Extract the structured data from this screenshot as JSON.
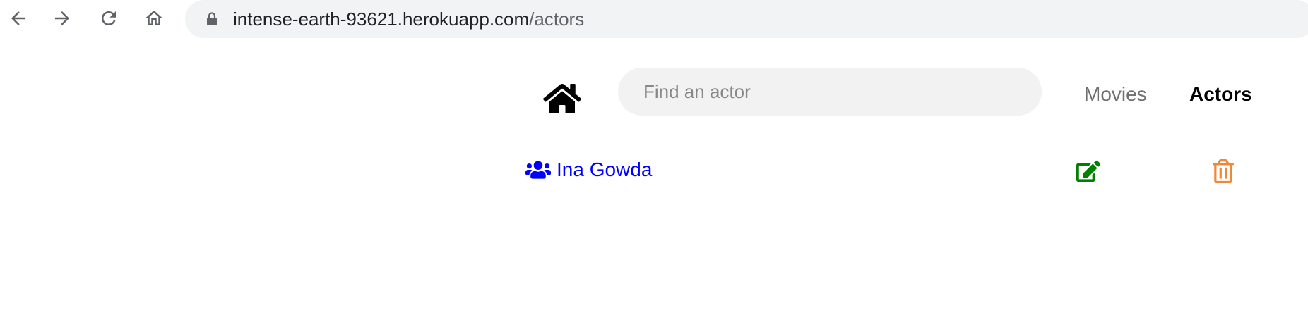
{
  "browser": {
    "url_host": "intense-earth-93621.herokuapp.com",
    "url_path": "/actors",
    "icons": [
      "back-arrow-icon",
      "forward-arrow-icon",
      "reload-icon",
      "home-icon",
      "lock-icon"
    ]
  },
  "navbar": {
    "home_icon": "home-icon",
    "search_placeholder": "Find an actor",
    "search_value": "",
    "links": [
      {
        "label": "Movies",
        "active": false
      },
      {
        "label": "Actors",
        "active": true
      }
    ]
  },
  "actors": [
    {
      "name": "Ina Gowda",
      "icon": "users-icon",
      "edit_icon": "edit-icon",
      "delete_icon": "trash-icon"
    }
  ],
  "colors": {
    "link": "#0000ff",
    "edit": "#008000",
    "delete": "#f0883a",
    "active_nav": "#000000",
    "inactive_nav": "#707070"
  }
}
